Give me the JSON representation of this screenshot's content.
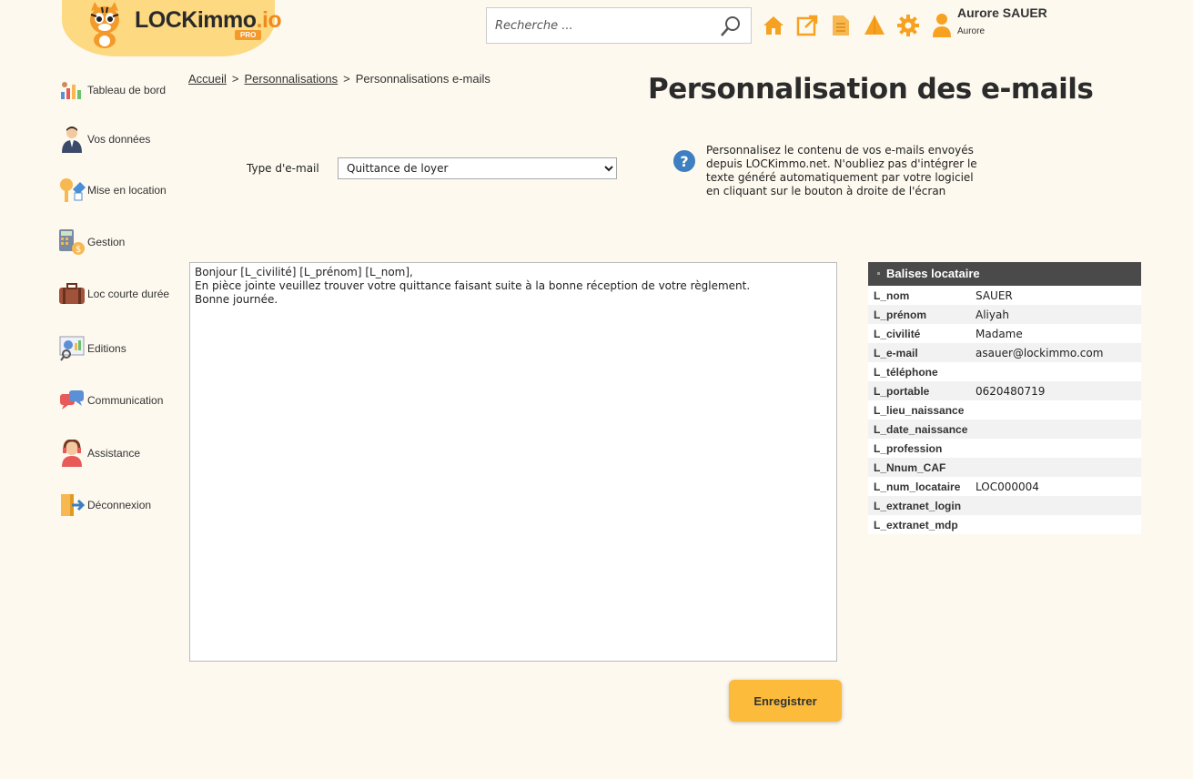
{
  "header": {
    "logo_text": "LOCKimmo",
    "logo_suffix": ".io",
    "logo_badge": "PRO",
    "search_placeholder": "Recherche ...",
    "user_name": "Aurore SAUER",
    "user_sub": "Aurore",
    "icons": [
      "home-icon",
      "external-link-icon",
      "document-icon",
      "notification-icon",
      "gear-icon",
      "user-icon"
    ],
    "accent_color": "#f7a121"
  },
  "sidebar": {
    "items": [
      {
        "label": "Tableau de bord",
        "icon": "dashboard-icon"
      },
      {
        "label": "Vos données",
        "icon": "person-icon"
      },
      {
        "label": "Mise en location",
        "icon": "keys-icon"
      },
      {
        "label": "Gestion",
        "icon": "calculator-icon"
      },
      {
        "label": "Loc courte durée",
        "icon": "suitcase-icon"
      },
      {
        "label": "Editions",
        "icon": "report-icon"
      },
      {
        "label": "Communication",
        "icon": "chat-icon"
      },
      {
        "label": "Assistance",
        "icon": "support-icon"
      },
      {
        "label": "Déconnexion",
        "icon": "logout-icon"
      }
    ]
  },
  "breadcrumb": {
    "home": "Accueil",
    "section": "Personnalisations",
    "current": "Personnalisations e-mails",
    "separator": ">"
  },
  "page": {
    "title": "Personnalisation des e-mails",
    "type_label": "Type d'e-mail",
    "type_selected": "Quittance de loyer",
    "help_text": "Personnalisez le contenu de vos e-mails envoyés depuis LOCKimmo.net. N'oubliez pas d'intégrer le texte généré automatiquement par votre logiciel en cliquant sur le bouton à droite de l'écran",
    "email_body": "Bonjour [L_civilité] [L_prénom] [L_nom],\nEn pièce jointe veuillez trouver votre quittance faisant suite à la bonne réception de votre règlement.\nBonne journée.",
    "save_label": "Enregistrer"
  },
  "tags": {
    "title": "Balises locataire",
    "rows": [
      {
        "key": "L_nom",
        "value": "SAUER"
      },
      {
        "key": "L_prénom",
        "value": "Aliyah"
      },
      {
        "key": "L_civilité",
        "value": "Madame"
      },
      {
        "key": "L_e-mail",
        "value": "asauer@lockimmo.com"
      },
      {
        "key": "L_téléphone",
        "value": ""
      },
      {
        "key": "L_portable",
        "value": "0620480719"
      },
      {
        "key": "L_lieu_naissance",
        "value": ""
      },
      {
        "key": "L_date_naissance",
        "value": ""
      },
      {
        "key": "L_profession",
        "value": ""
      },
      {
        "key": "L_Nnum_CAF",
        "value": ""
      },
      {
        "key": "L_num_locataire",
        "value": "LOC000004"
      },
      {
        "key": "L_extranet_login",
        "value": ""
      },
      {
        "key": "L_extranet_mdp",
        "value": ""
      }
    ]
  }
}
